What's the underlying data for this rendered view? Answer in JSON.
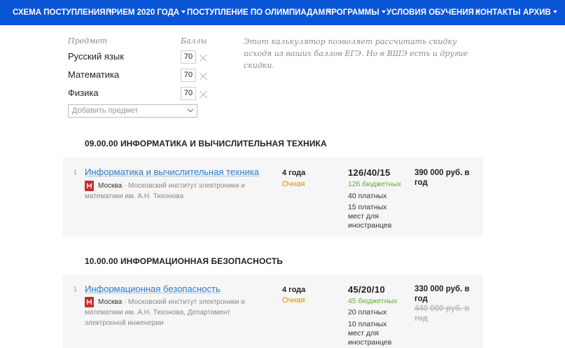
{
  "nav": {
    "items": [
      {
        "label": "СХЕМА ПОСТУПЛЕНИЯ",
        "dropdown": true
      },
      {
        "label": "ПРИЕМ 2020 ГОДА",
        "dropdown": true
      },
      {
        "label": "ПОСТУПЛЕНИЕ ПО ОЛИМПИАДАМ",
        "dropdown": true
      },
      {
        "label": "ПРОГРАММЫ",
        "dropdown": true
      },
      {
        "label": "УСЛОВИЯ ОБУЧЕНИЯ",
        "dropdown": true
      },
      {
        "label": "КОНТАКТЫ",
        "dropdown": false
      },
      {
        "label": "АРХИВ",
        "dropdown": true
      }
    ]
  },
  "calculator": {
    "subject_header": "Предмет",
    "score_header": "Баллы",
    "subjects": [
      {
        "name": "Русский язык",
        "score": "70"
      },
      {
        "name": "Математика",
        "score": "70"
      },
      {
        "name": "Физика",
        "score": "70"
      }
    ],
    "add_subject_placeholder": "Добавить предмет",
    "note": "Этот калькулятор позволяет рассчитать скидку исходя из ваших баллов ЕГЭ. Но в ВШЭ есть и другие скидки."
  },
  "sections": [
    {
      "title": "09.00.00 ИНФОРМАТИКА И ВЫЧИСЛИТЕЛЬНАЯ ТЕХНИКА",
      "programs": [
        {
          "num": "1",
          "name": "Информатика и вычислительная техника",
          "city": "Москва",
          "institute": "· Московский институт электроники и математики им. А.Н. Тихонова",
          "duration": "4 года",
          "form": "Очная",
          "places": "126/40/15",
          "budget": "126 бюджетных",
          "paid": "40 платных",
          "foreign": "15 платных мест для иностранцев",
          "price": "390 000 руб. в год",
          "old_price": ""
        }
      ]
    },
    {
      "title": "10.00.00 ИНФОРМАЦИОННАЯ БЕЗОПАСНОСТЬ",
      "programs": [
        {
          "num": "1",
          "name": "Информационная безопасность",
          "city": "Москва",
          "institute": "· Московский институт электроники и математики им. А.Н. Тихонова, Департамент электронной инженерии",
          "duration": "4 года",
          "form": "Очная",
          "places": "45/20/10",
          "budget": "45 бюджетных",
          "paid": "20 платных",
          "foreign": "10 платных мест для иностранцев",
          "price": "330 000 руб. в год",
          "old_price": "440 000 руб. в год"
        }
      ]
    }
  ],
  "colors": {
    "nav_bg": "#0a55d6",
    "link": "#2a79c9",
    "budget": "#5fae3a",
    "form": "#e08a00",
    "logo": "#c4302b"
  }
}
